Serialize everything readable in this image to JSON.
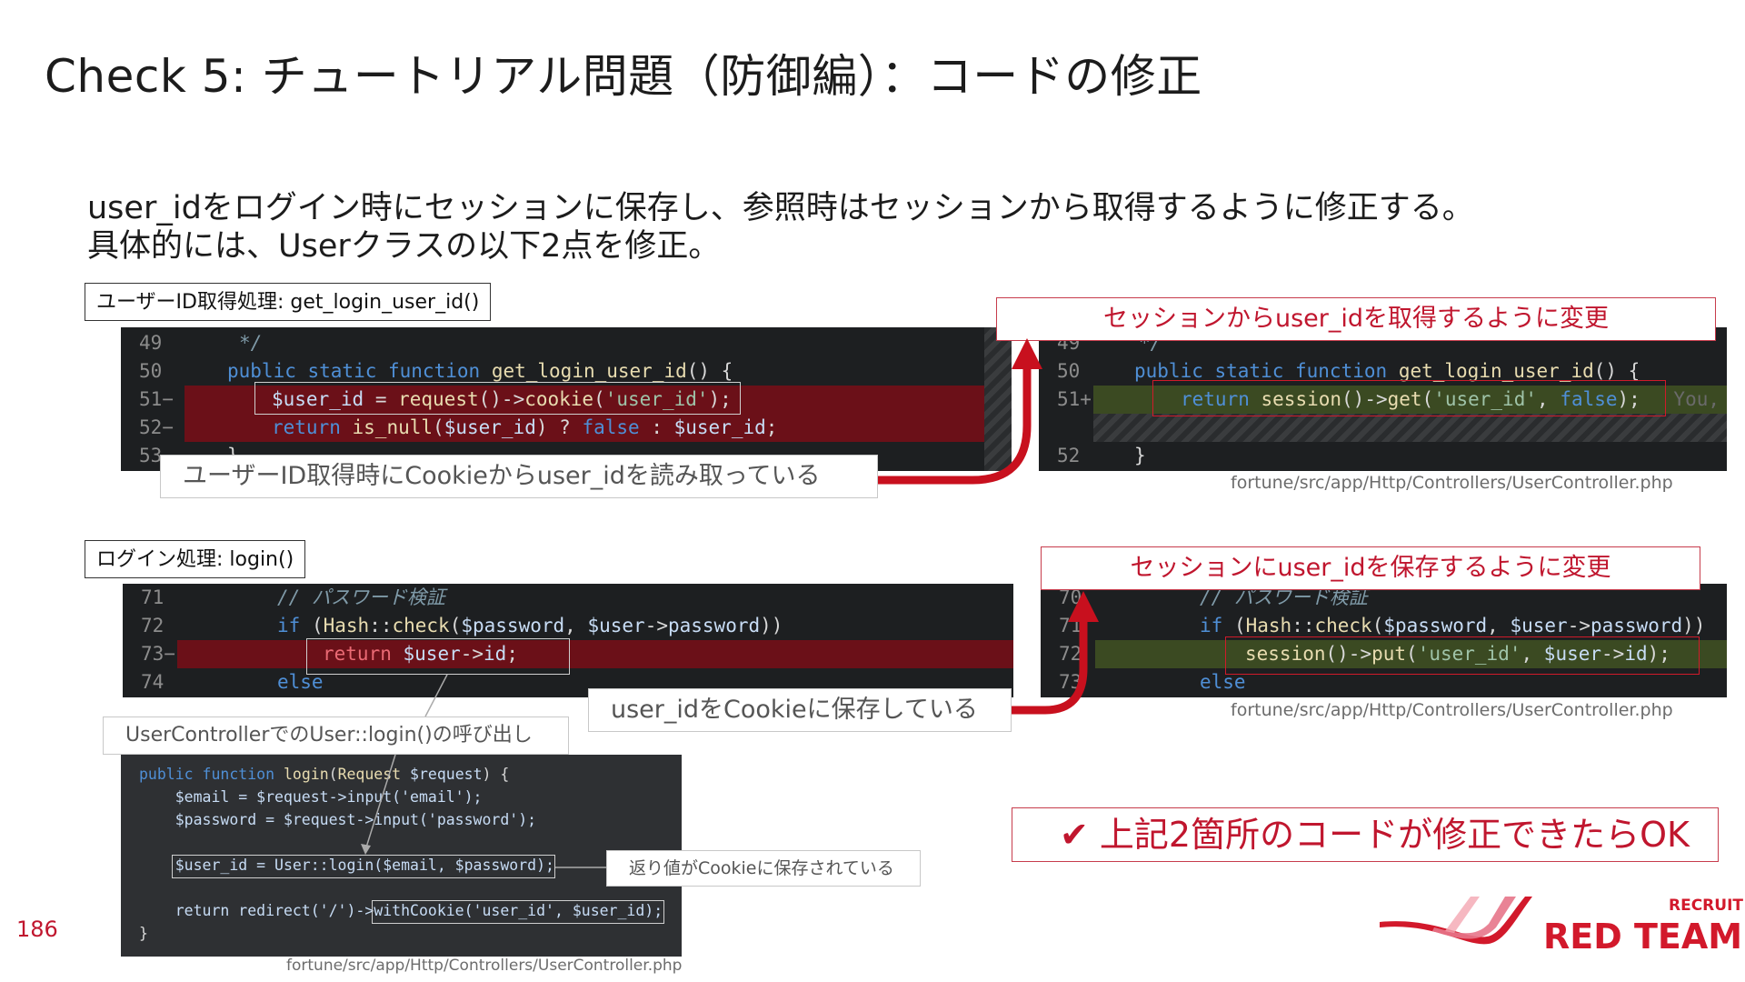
{
  "title": "Check 5: チュートリアル問題（防御編）：コードの修正",
  "intro": {
    "line1": "user_idをログイン時にセッションに保存し、参照時はセッションから取得するように修正する。",
    "line2": "具体的には、Userクラスの以下2点を修正。"
  },
  "section1": {
    "label": "ユーザーID取得処理: get_login_user_id()",
    "before_note": "ユーザーID取得時にCookieからuser_idを読み取っている",
    "after_note": "セッションからuser_idを取得するように変更",
    "file_path": "fortune/src/app/Http/Controllers/UserController.php",
    "before_lines": [
      {
        "num": "49",
        "text": "*/"
      },
      {
        "num": "50",
        "text": "public static function get_login_user_id() {"
      },
      {
        "num": "51−",
        "text": "$user_id = request()->cookie('user_id');"
      },
      {
        "num": "52−",
        "text": "return is_null($user_id) ? false : $user_id;"
      },
      {
        "num": "53",
        "text": "}"
      }
    ],
    "after_lines": [
      {
        "num": "49",
        "text": "*/"
      },
      {
        "num": "50",
        "text": "public static function get_login_user_id() {"
      },
      {
        "num": "51+",
        "text": "return session()->get('user_id', false);"
      },
      {
        "num": "52",
        "text": "}"
      }
    ],
    "blame": "You,"
  },
  "section2": {
    "label": "ログイン処理: login()",
    "before_note": "user_idをCookieに保存している",
    "after_note": "セッションにuser_idを保存するように変更",
    "file_path": "fortune/src/app/Http/Controllers/UserController.php",
    "before_lines": [
      {
        "num": "71",
        "text": "// パスワード検証"
      },
      {
        "num": "72",
        "text": "if (Hash::check($password, $user->password))"
      },
      {
        "num": "73−",
        "text": "return $user->id;"
      },
      {
        "num": "74",
        "text": "else"
      }
    ],
    "after_lines": [
      {
        "num": "70",
        "text": "// パスワード検証"
      },
      {
        "num": "71",
        "text": "if (Hash::check($password, $user->password))"
      },
      {
        "num": "72",
        "text": "session()->put('user_id', $user->id);"
      },
      {
        "num": "73",
        "text": "else"
      }
    ]
  },
  "controller": {
    "caption": "UserControllerでのUser::login()の呼び出し",
    "return_note": "返り値がCookieに保存されている",
    "file_path": "fortune/src/app/Http/Controllers/UserController.php",
    "lines": [
      "public function login(Request $request) {",
      "    $email = $request->input('email');",
      "    $password = $request->input('password');",
      "",
      "    $user_id = User::login($email, $password);",
      "",
      "    return redirect('/')->withCookie('user_id', $user_id);",
      "}"
    ]
  },
  "ok_message": "✔ 上記2箇所のコードが修正できたらOK",
  "page_number": "186",
  "logo": {
    "top": "RECRUIT",
    "main": "RED TEAM",
    "color": "#d2192b"
  }
}
